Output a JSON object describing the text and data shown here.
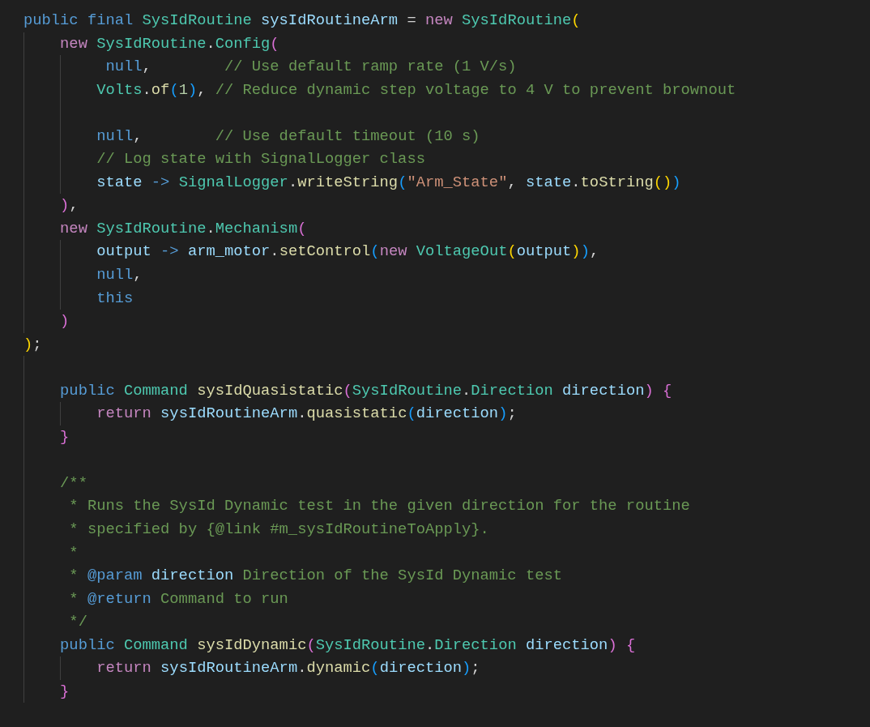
{
  "editor": {
    "lines": [
      {
        "kind": "code",
        "tokens": [
          {
            "text": "public final ",
            "kind": "keyword"
          },
          {
            "text": "SysIdRoutine ",
            "kind": "type"
          },
          {
            "text": "sysIdRoutineArm",
            "kind": "variable"
          },
          {
            "text": " = ",
            "kind": "plain"
          },
          {
            "text": "new ",
            "kind": "control"
          },
          {
            "text": "SysIdRoutine",
            "kind": "type"
          },
          {
            "text": "(",
            "kind": "bracket1"
          }
        ],
        "children": [
          {
            "kind": "code",
            "tokens": [
              {
                "text": "new ",
                "kind": "control"
              },
              {
                "text": "SysIdRoutine",
                "kind": "type"
              },
              {
                "text": ".",
                "kind": "plain"
              },
              {
                "text": "Config",
                "kind": "type"
              },
              {
                "text": "(",
                "kind": "bracket2"
              }
            ],
            "children": [
              {
                "kind": "code",
                "tokens": [
                  {
                    "text": " null",
                    "kind": "keyword"
                  },
                  {
                    "text": ",        ",
                    "kind": "plain"
                  },
                  {
                    "text": "// Use default ramp rate (1 V/s)",
                    "kind": "comment"
                  }
                ]
              },
              {
                "kind": "code",
                "tokens": [
                  {
                    "text": "Volts",
                    "kind": "type"
                  },
                  {
                    "text": ".",
                    "kind": "plain"
                  },
                  {
                    "text": "of",
                    "kind": "function"
                  },
                  {
                    "text": "(",
                    "kind": "bracket3"
                  },
                  {
                    "text": "1",
                    "kind": "number"
                  },
                  {
                    "text": ")",
                    "kind": "bracket3"
                  },
                  {
                    "text": ", ",
                    "kind": "plain"
                  },
                  {
                    "text": "// Reduce dynamic step voltage to 4 V to prevent brownout",
                    "kind": "comment"
                  }
                ]
              },
              {
                "kind": "blank"
              },
              {
                "kind": "code",
                "tokens": [
                  {
                    "text": "null",
                    "kind": "keyword"
                  },
                  {
                    "text": ",        ",
                    "kind": "plain"
                  },
                  {
                    "text": "// Use default timeout (10 s)",
                    "kind": "comment"
                  }
                ]
              },
              {
                "kind": "code",
                "tokens": [
                  {
                    "text": "// Log state with SignalLogger class",
                    "kind": "comment"
                  }
                ]
              },
              {
                "kind": "code",
                "tokens": [
                  {
                    "text": "state ",
                    "kind": "variable"
                  },
                  {
                    "text": "-> ",
                    "kind": "keyword"
                  },
                  {
                    "text": "SignalLogger",
                    "kind": "type"
                  },
                  {
                    "text": ".",
                    "kind": "plain"
                  },
                  {
                    "text": "writeString",
                    "kind": "function"
                  },
                  {
                    "text": "(",
                    "kind": "bracket3"
                  },
                  {
                    "text": "\"Arm_State\"",
                    "kind": "string"
                  },
                  {
                    "text": ", ",
                    "kind": "plain"
                  },
                  {
                    "text": "state",
                    "kind": "variable"
                  },
                  {
                    "text": ".",
                    "kind": "plain"
                  },
                  {
                    "text": "toString",
                    "kind": "function"
                  },
                  {
                    "text": "()",
                    "kind": "bracket1"
                  },
                  {
                    "text": ")",
                    "kind": "bracket3"
                  }
                ]
              }
            ]
          },
          {
            "kind": "code",
            "tokens": [
              {
                "text": ")",
                "kind": "bracket2"
              },
              {
                "text": ",",
                "kind": "plain"
              }
            ]
          },
          {
            "kind": "code",
            "tokens": [
              {
                "text": "new ",
                "kind": "control"
              },
              {
                "text": "SysIdRoutine",
                "kind": "type"
              },
              {
                "text": ".",
                "kind": "plain"
              },
              {
                "text": "Mechanism",
                "kind": "type"
              },
              {
                "text": "(",
                "kind": "bracket2"
              }
            ],
            "children": [
              {
                "kind": "code",
                "tokens": [
                  {
                    "text": "output ",
                    "kind": "variable"
                  },
                  {
                    "text": "-> ",
                    "kind": "keyword"
                  },
                  {
                    "text": "arm_motor",
                    "kind": "variable"
                  },
                  {
                    "text": ".",
                    "kind": "plain"
                  },
                  {
                    "text": "setControl",
                    "kind": "function"
                  },
                  {
                    "text": "(",
                    "kind": "bracket3"
                  },
                  {
                    "text": "new ",
                    "kind": "control"
                  },
                  {
                    "text": "VoltageOut",
                    "kind": "type"
                  },
                  {
                    "text": "(",
                    "kind": "bracket1"
                  },
                  {
                    "text": "output",
                    "kind": "variable"
                  },
                  {
                    "text": ")",
                    "kind": "bracket1"
                  },
                  {
                    "text": ")",
                    "kind": "bracket3"
                  },
                  {
                    "text": ",",
                    "kind": "plain"
                  }
                ]
              },
              {
                "kind": "code",
                "tokens": [
                  {
                    "text": "null",
                    "kind": "keyword"
                  },
                  {
                    "text": ",",
                    "kind": "plain"
                  }
                ]
              },
              {
                "kind": "code",
                "tokens": [
                  {
                    "text": "this",
                    "kind": "keyword"
                  }
                ]
              }
            ]
          },
          {
            "kind": "code",
            "tokens": [
              {
                "text": ")",
                "kind": "bracket2"
              }
            ]
          }
        ]
      },
      {
        "kind": "code",
        "tokens": [
          {
            "text": ")",
            "kind": "bracket1"
          },
          {
            "text": ";",
            "kind": "plain"
          }
        ]
      },
      {
        "kind": "block",
        "children": [
          {
            "kind": "blank"
          },
          {
            "kind": "code",
            "tokens": [
              {
                "text": "public ",
                "kind": "keyword"
              },
              {
                "text": "Command ",
                "kind": "type"
              },
              {
                "text": "sysIdQuasistatic",
                "kind": "function"
              },
              {
                "text": "(",
                "kind": "bracket2"
              },
              {
                "text": "SysIdRoutine",
                "kind": "type"
              },
              {
                "text": ".",
                "kind": "plain"
              },
              {
                "text": "Direction ",
                "kind": "type"
              },
              {
                "text": "direction",
                "kind": "variable"
              },
              {
                "text": ") ",
                "kind": "bracket2"
              },
              {
                "text": "{",
                "kind": "bracket2"
              }
            ],
            "children": [
              {
                "kind": "code",
                "tokens": [
                  {
                    "text": "return ",
                    "kind": "control"
                  },
                  {
                    "text": "sysIdRoutineArm",
                    "kind": "variable"
                  },
                  {
                    "text": ".",
                    "kind": "plain"
                  },
                  {
                    "text": "quasistatic",
                    "kind": "function"
                  },
                  {
                    "text": "(",
                    "kind": "bracket3"
                  },
                  {
                    "text": "direction",
                    "kind": "variable"
                  },
                  {
                    "text": ")",
                    "kind": "bracket3"
                  },
                  {
                    "text": ";",
                    "kind": "plain"
                  }
                ]
              }
            ]
          },
          {
            "kind": "code",
            "tokens": [
              {
                "text": "}",
                "kind": "bracket2"
              }
            ]
          },
          {
            "kind": "blank"
          },
          {
            "kind": "code",
            "tokens": [
              {
                "text": "/**",
                "kind": "comment"
              }
            ]
          },
          {
            "kind": "code",
            "tokens": [
              {
                "text": " * Runs the SysId Dynamic test in the given direction for the routine",
                "kind": "comment"
              }
            ]
          },
          {
            "kind": "code",
            "tokens": [
              {
                "text": " * specified by {@link #m_sysIdRoutineToApply}.",
                "kind": "comment"
              }
            ]
          },
          {
            "kind": "code",
            "tokens": [
              {
                "text": " *",
                "kind": "comment"
              }
            ]
          },
          {
            "kind": "code",
            "tokens": [
              {
                "text": " * ",
                "kind": "comment"
              },
              {
                "text": "@param ",
                "kind": "keyword"
              },
              {
                "text": "direction",
                "kind": "variable"
              },
              {
                "text": " Direction of the SysId Dynamic test",
                "kind": "comment"
              }
            ]
          },
          {
            "kind": "code",
            "tokens": [
              {
                "text": " * ",
                "kind": "comment"
              },
              {
                "text": "@return",
                "kind": "keyword"
              },
              {
                "text": " Command to run",
                "kind": "comment"
              }
            ]
          },
          {
            "kind": "code",
            "tokens": [
              {
                "text": " */",
                "kind": "comment"
              }
            ]
          },
          {
            "kind": "code",
            "tokens": [
              {
                "text": "public ",
                "kind": "keyword"
              },
              {
                "text": "Command ",
                "kind": "type"
              },
              {
                "text": "sysIdDynamic",
                "kind": "function"
              },
              {
                "text": "(",
                "kind": "bracket2"
              },
              {
                "text": "SysIdRoutine",
                "kind": "type"
              },
              {
                "text": ".",
                "kind": "plain"
              },
              {
                "text": "Direction ",
                "kind": "type"
              },
              {
                "text": "direction",
                "kind": "variable"
              },
              {
                "text": ") ",
                "kind": "bracket2"
              },
              {
                "text": "{",
                "kind": "bracket2"
              }
            ],
            "children": [
              {
                "kind": "code",
                "tokens": [
                  {
                    "text": "return ",
                    "kind": "control"
                  },
                  {
                    "text": "sysIdRoutineArm",
                    "kind": "variable"
                  },
                  {
                    "text": ".",
                    "kind": "plain"
                  },
                  {
                    "text": "dynamic",
                    "kind": "function"
                  },
                  {
                    "text": "(",
                    "kind": "bracket3"
                  },
                  {
                    "text": "direction",
                    "kind": "variable"
                  },
                  {
                    "text": ")",
                    "kind": "bracket3"
                  },
                  {
                    "text": ";",
                    "kind": "plain"
                  }
                ]
              }
            ]
          },
          {
            "kind": "code",
            "tokens": [
              {
                "text": "}",
                "kind": "bracket2"
              }
            ]
          }
        ]
      }
    ]
  }
}
